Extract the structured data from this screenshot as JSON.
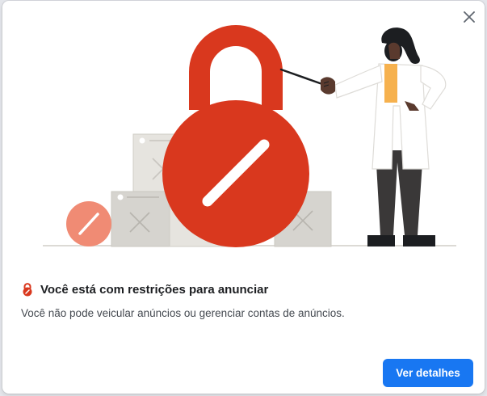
{
  "dialog": {
    "title": "Você está com restrições para anunciar",
    "description": "Você não pode veicular anúncios ou gerenciar contas de anúncios.",
    "primary_button_label": "Ver detalhes"
  },
  "colors": {
    "lock_red": "#d9381e",
    "badge_salmon": "#f08b74",
    "primary_blue": "#1877f2",
    "card_gray": "#d6d4cf"
  },
  "icons": {
    "close": "close-icon",
    "title_icon": "lock-icon"
  }
}
